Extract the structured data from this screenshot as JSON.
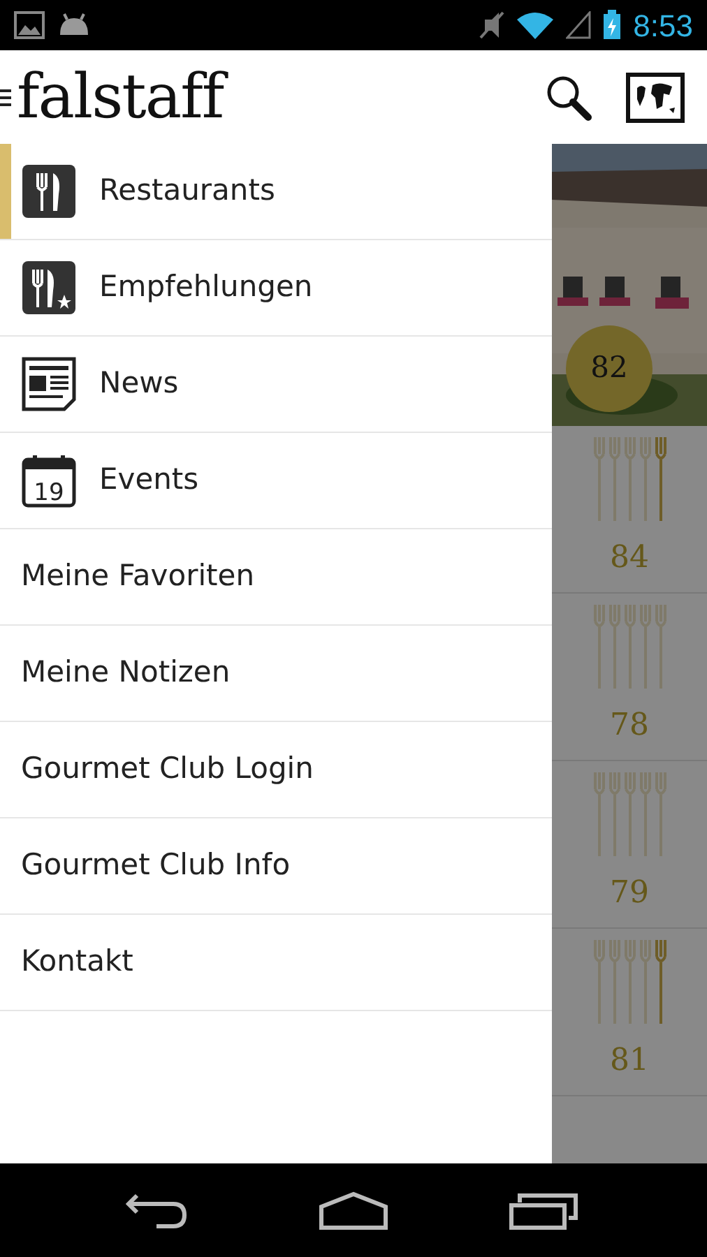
{
  "status_bar": {
    "time": "8:53"
  },
  "header": {
    "logo": "falstaff"
  },
  "drawer": {
    "items": [
      {
        "label": "Restaurants",
        "kind": "icon",
        "selected": true
      },
      {
        "label": "Empfehlungen",
        "kind": "icon",
        "selected": false
      },
      {
        "label": "News",
        "kind": "icon",
        "selected": false
      },
      {
        "label": "Events",
        "kind": "icon",
        "selected": false,
        "icon_text": "19"
      },
      {
        "label": "Meine Favoriten",
        "kind": "text",
        "selected": false
      },
      {
        "label": "Meine Notizen",
        "kind": "text",
        "selected": false
      },
      {
        "label": "Gourmet Club Login",
        "kind": "text",
        "selected": false
      },
      {
        "label": "Gourmet Club Info",
        "kind": "text",
        "selected": false
      },
      {
        "label": "Kontakt",
        "kind": "text",
        "selected": false
      }
    ]
  },
  "background_list": {
    "featured": {
      "kind": "picture",
      "score": "82"
    },
    "rows": [
      {
        "score": "84",
        "highlighted": true
      },
      {
        "score": "78",
        "highlighted": false
      },
      {
        "score": "79",
        "highlighted": false
      },
      {
        "score": "81",
        "highlighted": true
      }
    ]
  }
}
